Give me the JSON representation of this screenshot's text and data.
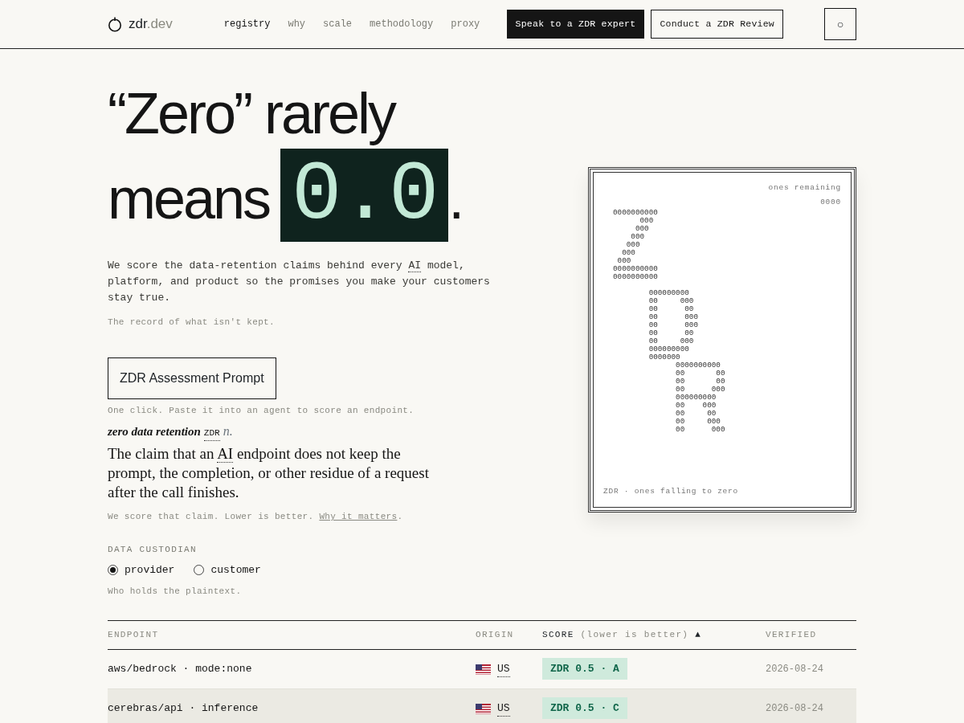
{
  "header": {
    "logo": {
      "name": "zdr",
      "suffix": ".dev"
    },
    "nav": [
      {
        "label": "registry",
        "selected": true
      },
      {
        "label": "why",
        "selected": false
      },
      {
        "label": "scale",
        "selected": false
      },
      {
        "label": "methodology",
        "selected": false
      },
      {
        "label": "proxy",
        "selected": false
      }
    ],
    "buttons": [
      {
        "label": "Speak to a ZDR expert",
        "kind": "solid"
      },
      {
        "label": "Conduct a ZDR Review",
        "kind": "outline"
      }
    ],
    "theme_toggle": "○"
  },
  "hero": {
    "headline_line1": "“Zero” rarely",
    "headline_word": "means",
    "headline_value": "0.0",
    "headline_end": ".",
    "intro": {
      "before": "We score the data-retention claims behind every ",
      "abbr": "AI",
      "after": " model, platform, and product so the promises you make your customers stay true."
    },
    "tagline": "The record of what isn't kept.",
    "prompt_button": "ZDR Assessment Prompt",
    "prompt_hint": "One click. Paste it into an agent to score an endpoint.",
    "definition": {
      "term": "zero data retention",
      "abbr": "ZDR",
      "pos": "n.",
      "before": "The claim that an ",
      "abbr2": "AI",
      "after": " endpoint does not keep the prompt, the completion, or other residue of a request after the call finishes."
    },
    "note": {
      "text": "We score that claim. Lower is better. ",
      "link": "Why it matters",
      "end": "."
    },
    "custodian": {
      "label": "DATA CUSTODIAN",
      "options": [
        {
          "label": "provider",
          "selected": true
        },
        {
          "label": "customer",
          "selected": false
        }
      ],
      "hint": "Who holds the plaintext."
    }
  },
  "art": {
    "counter_label": "ones remaining",
    "counter": "0000",
    "groups": [
      {
        "lines": [
          "0000000000",
          "      000",
          "     000",
          "    000",
          "   000",
          "  000",
          " 000",
          "0000000000",
          "0000000000"
        ]
      },
      {
        "lines": [
          "        000000000",
          "        00     000",
          "        00      00",
          "        00      000",
          "        00      000",
          "        00      00",
          "        00     000",
          "        000000000",
          "        0000000",
          "              0000000000",
          "              00       00",
          "              00       00",
          "              00      000",
          "              000000000",
          "              00    000",
          "              00     00",
          "              00     000",
          "              00      000"
        ]
      }
    ],
    "caption": "ZDR · ones falling to zero"
  },
  "table": {
    "columns": [
      {
        "label": "ENDPOINT",
        "selected": false
      },
      {
        "label": "ORIGIN",
        "selected": false
      },
      {
        "label": "SCORE",
        "selected": true,
        "note": "(lower is better)",
        "sort": "▲"
      },
      {
        "label": "VERIFIED",
        "selected": false
      }
    ],
    "rows": [
      {
        "endpoint": "aws/bedrock · mode:none",
        "origin": "US",
        "score": "ZDR 0.5 · A",
        "verified": "2026-08-24",
        "highlighted": false
      },
      {
        "endpoint": "cerebras/api · inference",
        "origin": "US",
        "score": "ZDR 0.5 · C",
        "verified": "2026-08-24",
        "highlighted": true
      }
    ]
  }
}
